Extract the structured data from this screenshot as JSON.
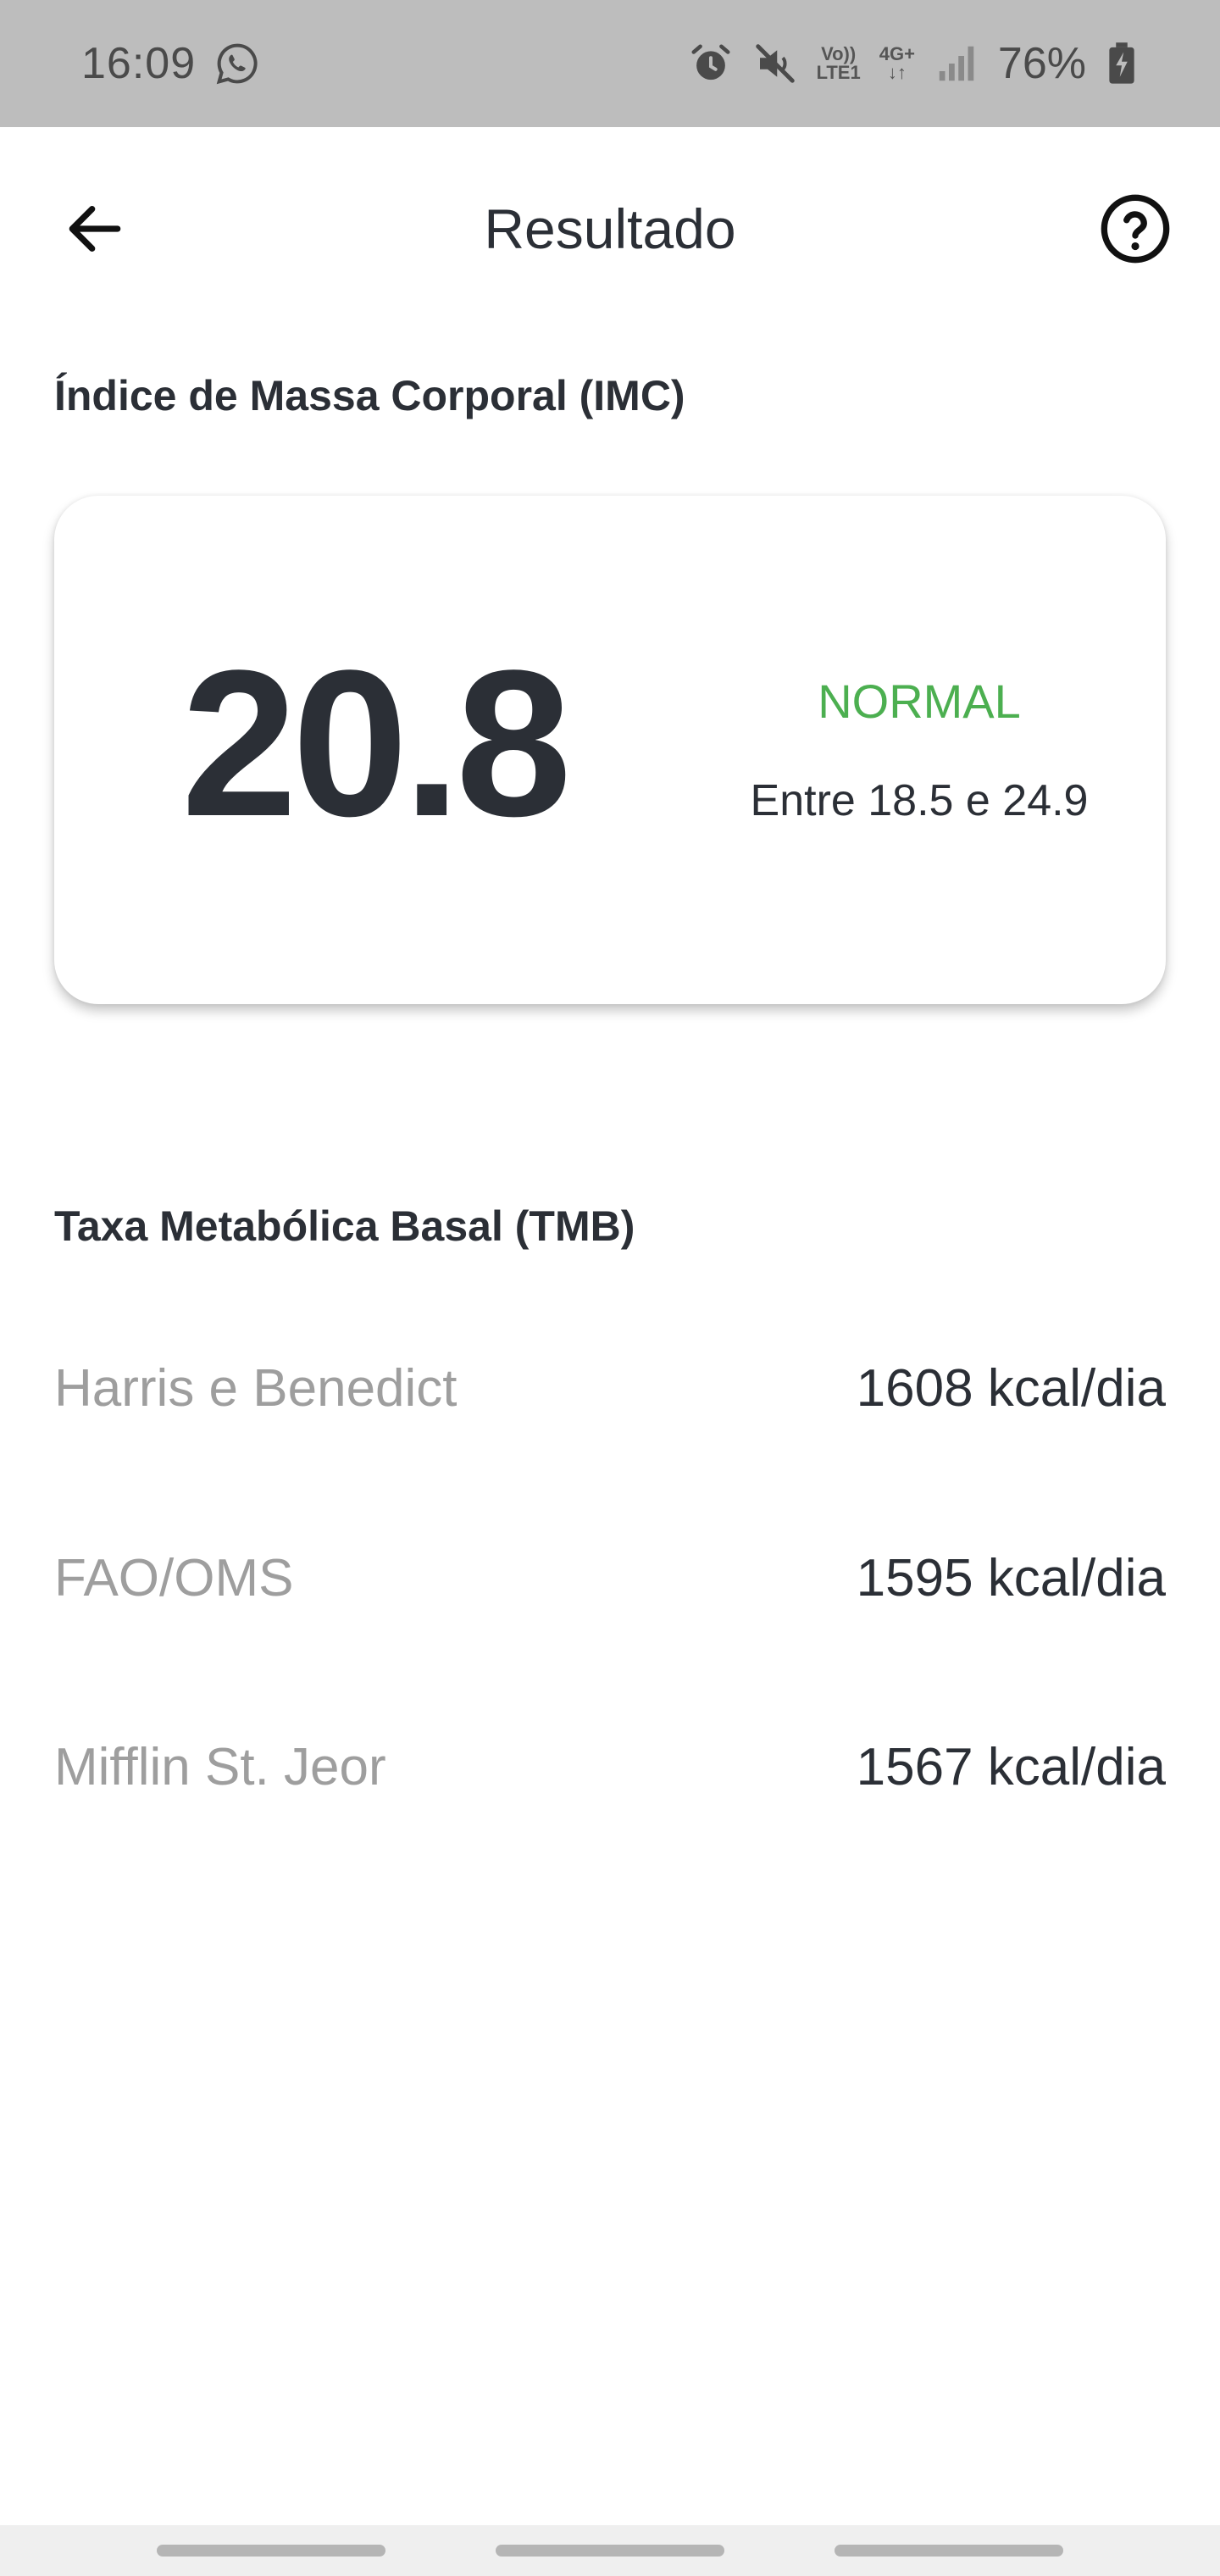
{
  "status_bar": {
    "time": "16:09",
    "volte_top": "Vo))",
    "volte_bottom": "LTE1",
    "network": "4G+",
    "battery": "76%"
  },
  "app_bar": {
    "title": "Resultado"
  },
  "imc": {
    "section_title": "Índice de Massa Corporal (IMC)",
    "value": "20.8",
    "status": "NORMAL",
    "range": "Entre 18.5 e 24.9",
    "status_color": "#4caf50"
  },
  "tmb": {
    "section_title": "Taxa Metabólica Basal (TMB)",
    "rows": [
      {
        "method": "Harris e Benedict",
        "value": "1608 kcal/dia"
      },
      {
        "method": "FAO/OMS",
        "value": "1595 kcal/dia"
      },
      {
        "method": "Mifflin St. Jeor",
        "value": "1567 kcal/dia"
      }
    ]
  }
}
